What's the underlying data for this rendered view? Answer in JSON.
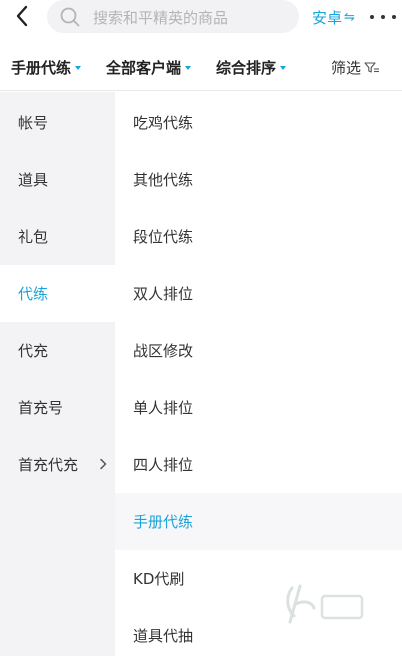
{
  "search": {
    "placeholder": "搜索和平精英的商品"
  },
  "platform": {
    "label": "安卓",
    "swap_glyph": "⇋"
  },
  "filters": {
    "service": "手册代练",
    "customer": "全部客户端",
    "sort": "综合排序",
    "screen": "筛选"
  },
  "left_categories": [
    {
      "label": "帐号"
    },
    {
      "label": "道具"
    },
    {
      "label": "礼包"
    },
    {
      "label": "代练",
      "active": true
    },
    {
      "label": "代充"
    },
    {
      "label": "首充号"
    },
    {
      "label": "首充代充"
    }
  ],
  "sub_categories": [
    {
      "label": "吃鸡代练"
    },
    {
      "label": "其他代练"
    },
    {
      "label": "段位代练"
    },
    {
      "label": "双人排位"
    },
    {
      "label": "战区修改"
    },
    {
      "label": "单人排位"
    },
    {
      "label": "四人排位"
    },
    {
      "label": "手册代练",
      "active": true
    },
    {
      "label": "KD代刷"
    },
    {
      "label": "道具代抽"
    }
  ],
  "colors": {
    "accent": "#1aa3d9",
    "left_bg": "#f3f3f5",
    "text": "#333333"
  }
}
